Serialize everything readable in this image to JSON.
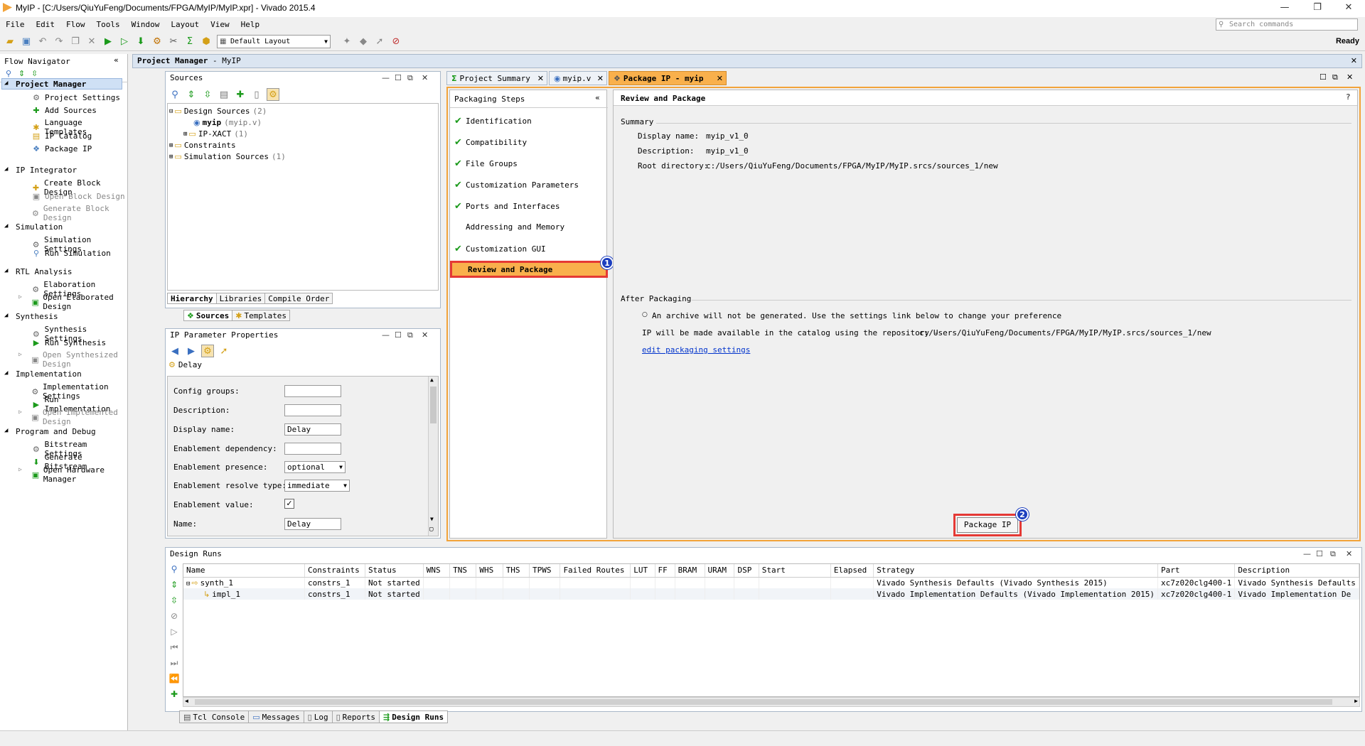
{
  "window": {
    "title": "MyIP - [C:/Users/QiuYuFeng/Documents/FPGA/MyIP/MyIP.xpr] - Vivado 2015.4",
    "controls": [
      "—",
      "❐",
      "✕"
    ]
  },
  "menu": [
    "File",
    "Edit",
    "Flow",
    "Tools",
    "Window",
    "Layout",
    "View",
    "Help"
  ],
  "search_placeholder": "Search commands",
  "toolbar": {
    "layout_value": "Default Layout",
    "status": "Ready"
  },
  "flow_navigator": {
    "title": "Flow Navigator",
    "sections": [
      {
        "label": "Project Manager",
        "items": [
          "Project Settings",
          "Add Sources",
          "Language Templates",
          "IP Catalog",
          "Package IP"
        ]
      },
      {
        "label": "IP Integrator",
        "items": [
          "Create Block Design",
          "Open Block Design",
          "Generate Block Design"
        ]
      },
      {
        "label": "Simulation",
        "items": [
          "Simulation Settings",
          "Run Simulation"
        ]
      },
      {
        "label": "RTL Analysis",
        "items": [
          "Elaboration Settings",
          "Open Elaborated Design"
        ]
      },
      {
        "label": "Synthesis",
        "items": [
          "Synthesis Settings",
          "Run Synthesis",
          "Open Synthesized Design"
        ]
      },
      {
        "label": "Implementation",
        "items": [
          "Implementation Settings",
          "Run Implementation",
          "Open Implemented Design"
        ]
      },
      {
        "label": "Program and Debug",
        "items": [
          "Bitstream Settings",
          "Generate Bitstream",
          "Open Hardware Manager"
        ]
      }
    ]
  },
  "project_manager": {
    "title": "Project Manager",
    "project": "- MyIP"
  },
  "sources": {
    "title": "Sources",
    "tree": {
      "design_sources": "Design Sources",
      "design_count": "(2)",
      "myip": "myip",
      "myip_file": "(myip.v)",
      "ipxact": "IP-XACT",
      "ipxact_count": "(1)",
      "constraints": "Constraints",
      "sim_sources": "Simulation Sources",
      "sim_count": "(1)"
    },
    "tabs": [
      "Hierarchy",
      "Libraries",
      "Compile Order"
    ],
    "subtabs": [
      "Sources",
      "Templates"
    ]
  },
  "ip_params": {
    "title": "IP Parameter Properties",
    "selected": "Delay",
    "fields": [
      {
        "label": "Config groups:",
        "value": ""
      },
      {
        "label": "Description:",
        "value": ""
      },
      {
        "label": "Display name:",
        "value": "Delay"
      },
      {
        "label": "Enablement dependency:",
        "value": ""
      },
      {
        "label": "Enablement presence:",
        "value": "optional"
      },
      {
        "label": "Enablement resolve type:",
        "value": "immediate"
      },
      {
        "label": "Enablement value:",
        "value": "✓"
      },
      {
        "label": "Name:",
        "value": "Delay"
      }
    ]
  },
  "doc_tabs": [
    "Project Summary",
    "myip.v",
    "Package IP - myip"
  ],
  "packaging_steps": {
    "title": "Packaging Steps",
    "steps": [
      {
        "label": "Identification",
        "done": true
      },
      {
        "label": "Compatibility",
        "done": true
      },
      {
        "label": "File Groups",
        "done": true
      },
      {
        "label": "Customization Parameters",
        "done": true
      },
      {
        "label": "Ports and Interfaces",
        "done": true
      },
      {
        "label": "Addressing and Memory",
        "done": false
      },
      {
        "label": "Customization GUI",
        "done": true
      },
      {
        "label": "Review and Package",
        "done": false
      }
    ]
  },
  "review": {
    "title": "Review and Package",
    "help": "?",
    "summary_title": "Summary",
    "display_name_label": "Display name:",
    "display_name": "myip_v1_0",
    "description_label": "Description:",
    "description": "myip_v1_0",
    "root_label": "Root directory:",
    "root": "c:/Users/QiuYuFeng/Documents/FPGA/MyIP/MyIP.srcs/sources_1/new",
    "after_title": "After Packaging",
    "after_line1": "An archive will not be generated. Use the settings link below to change your preference",
    "after_line2_prefix": "IP will be made available in the catalog using the repository -",
    "after_line2_path": "c:/Users/QiuYuFeng/Documents/FPGA/MyIP/MyIP.srcs/sources_1/new",
    "edit_link": "edit packaging settings",
    "package_button": "Package IP"
  },
  "badges": {
    "one": "1",
    "two": "2"
  },
  "design_runs": {
    "title": "Design Runs",
    "columns": [
      "Name",
      "Constraints",
      "Status",
      "WNS",
      "TNS",
      "WHS",
      "THS",
      "TPWS",
      "Failed Routes",
      "LUT",
      "FF",
      "BRAM",
      "URAM",
      "DSP",
      "Start",
      "Elapsed",
      "Strategy",
      "Part",
      "Description"
    ],
    "rows": [
      {
        "name": "synth_1",
        "constraints": "constrs_1",
        "status": "Not started",
        "strategy": "Vivado Synthesis Defaults (Vivado Synthesis 2015)",
        "part": "xc7z020clg400-1",
        "description": "Vivado Synthesis Defaults"
      },
      {
        "name": "impl_1",
        "constraints": "constrs_1",
        "status": "Not started",
        "strategy": "Vivado Implementation Defaults (Vivado Implementation 2015)",
        "part": "xc7z020clg400-1",
        "description": "Vivado Implementation De"
      }
    ]
  },
  "bottom_tabs": [
    "Tcl Console",
    "Messages",
    "Log",
    "Reports",
    "Design Runs"
  ],
  "colors": {
    "active_tab": "#f9b04c",
    "highlight": "#e53935",
    "badge": "#1d3fbf",
    "check": "#1b9a1b",
    "link": "#0033cc"
  }
}
